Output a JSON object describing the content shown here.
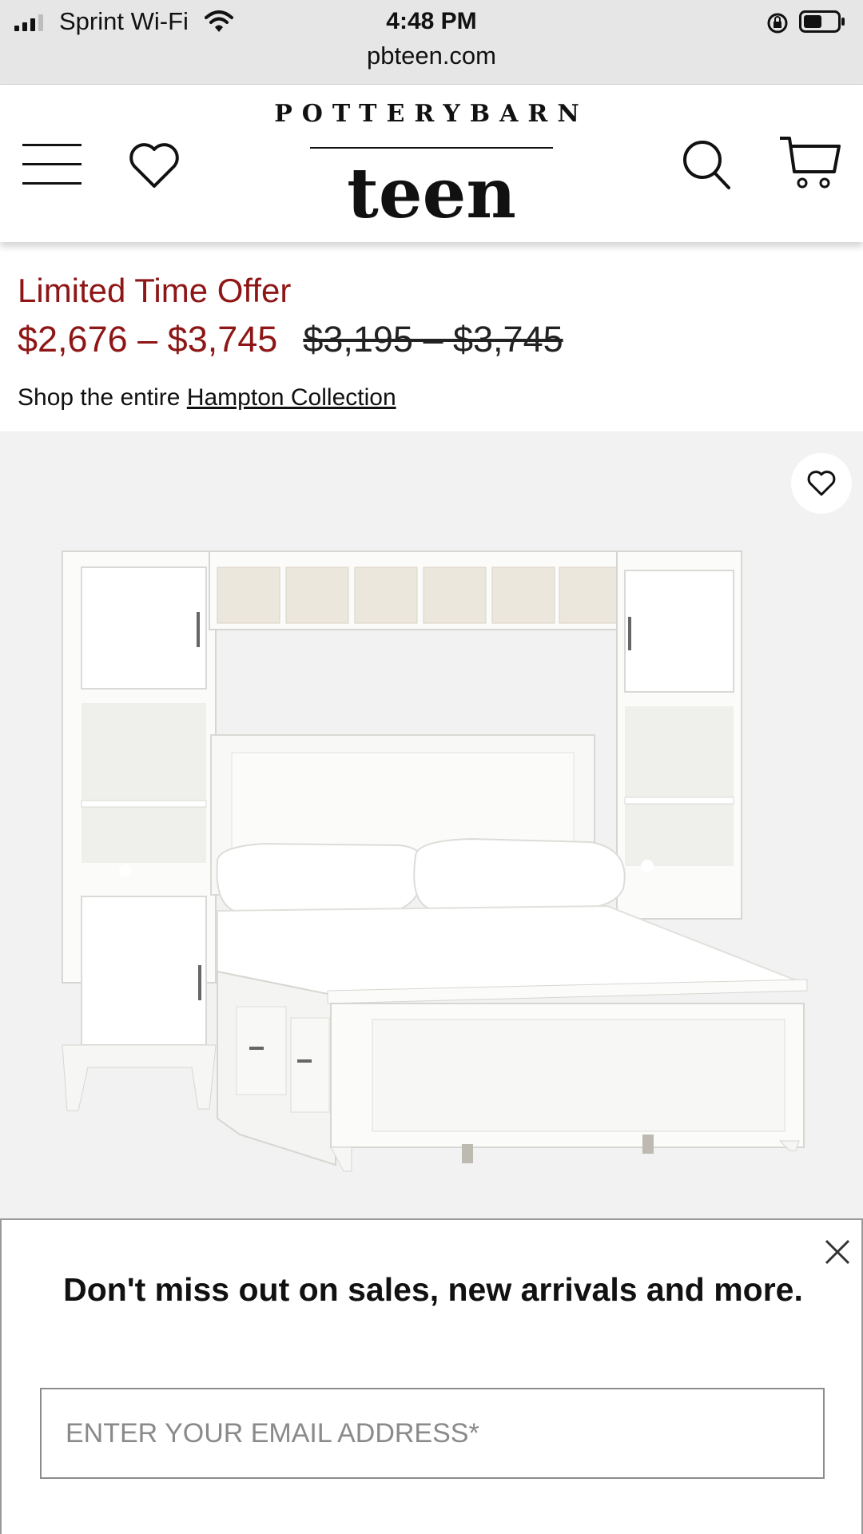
{
  "status_bar": {
    "carrier": "Sprint Wi-Fi",
    "time": "4:48 PM",
    "url": "pbteen.com"
  },
  "header": {
    "brand_top": "POTTERYBARN",
    "brand_main": "teen",
    "icons": [
      "hamburger-menu-icon",
      "heart-icon",
      "search-icon",
      "cart-icon"
    ]
  },
  "product": {
    "offer_label": "Limited Time Offer",
    "sale_price": "$2,676 – $3,745",
    "original_price": "$3,195 – $3,745",
    "shop_prefix": "Shop the entire ",
    "shop_link": "Hampton Collection"
  },
  "popup": {
    "title": "Don't miss out on sales, new arrivals and more.",
    "email_placeholder": "ENTER YOUR EMAIL ADDRESS*"
  },
  "colors": {
    "sale_red": "#8e1616",
    "status_bar_bg": "#e6e6e6",
    "image_bg": "#f2f2f2"
  }
}
